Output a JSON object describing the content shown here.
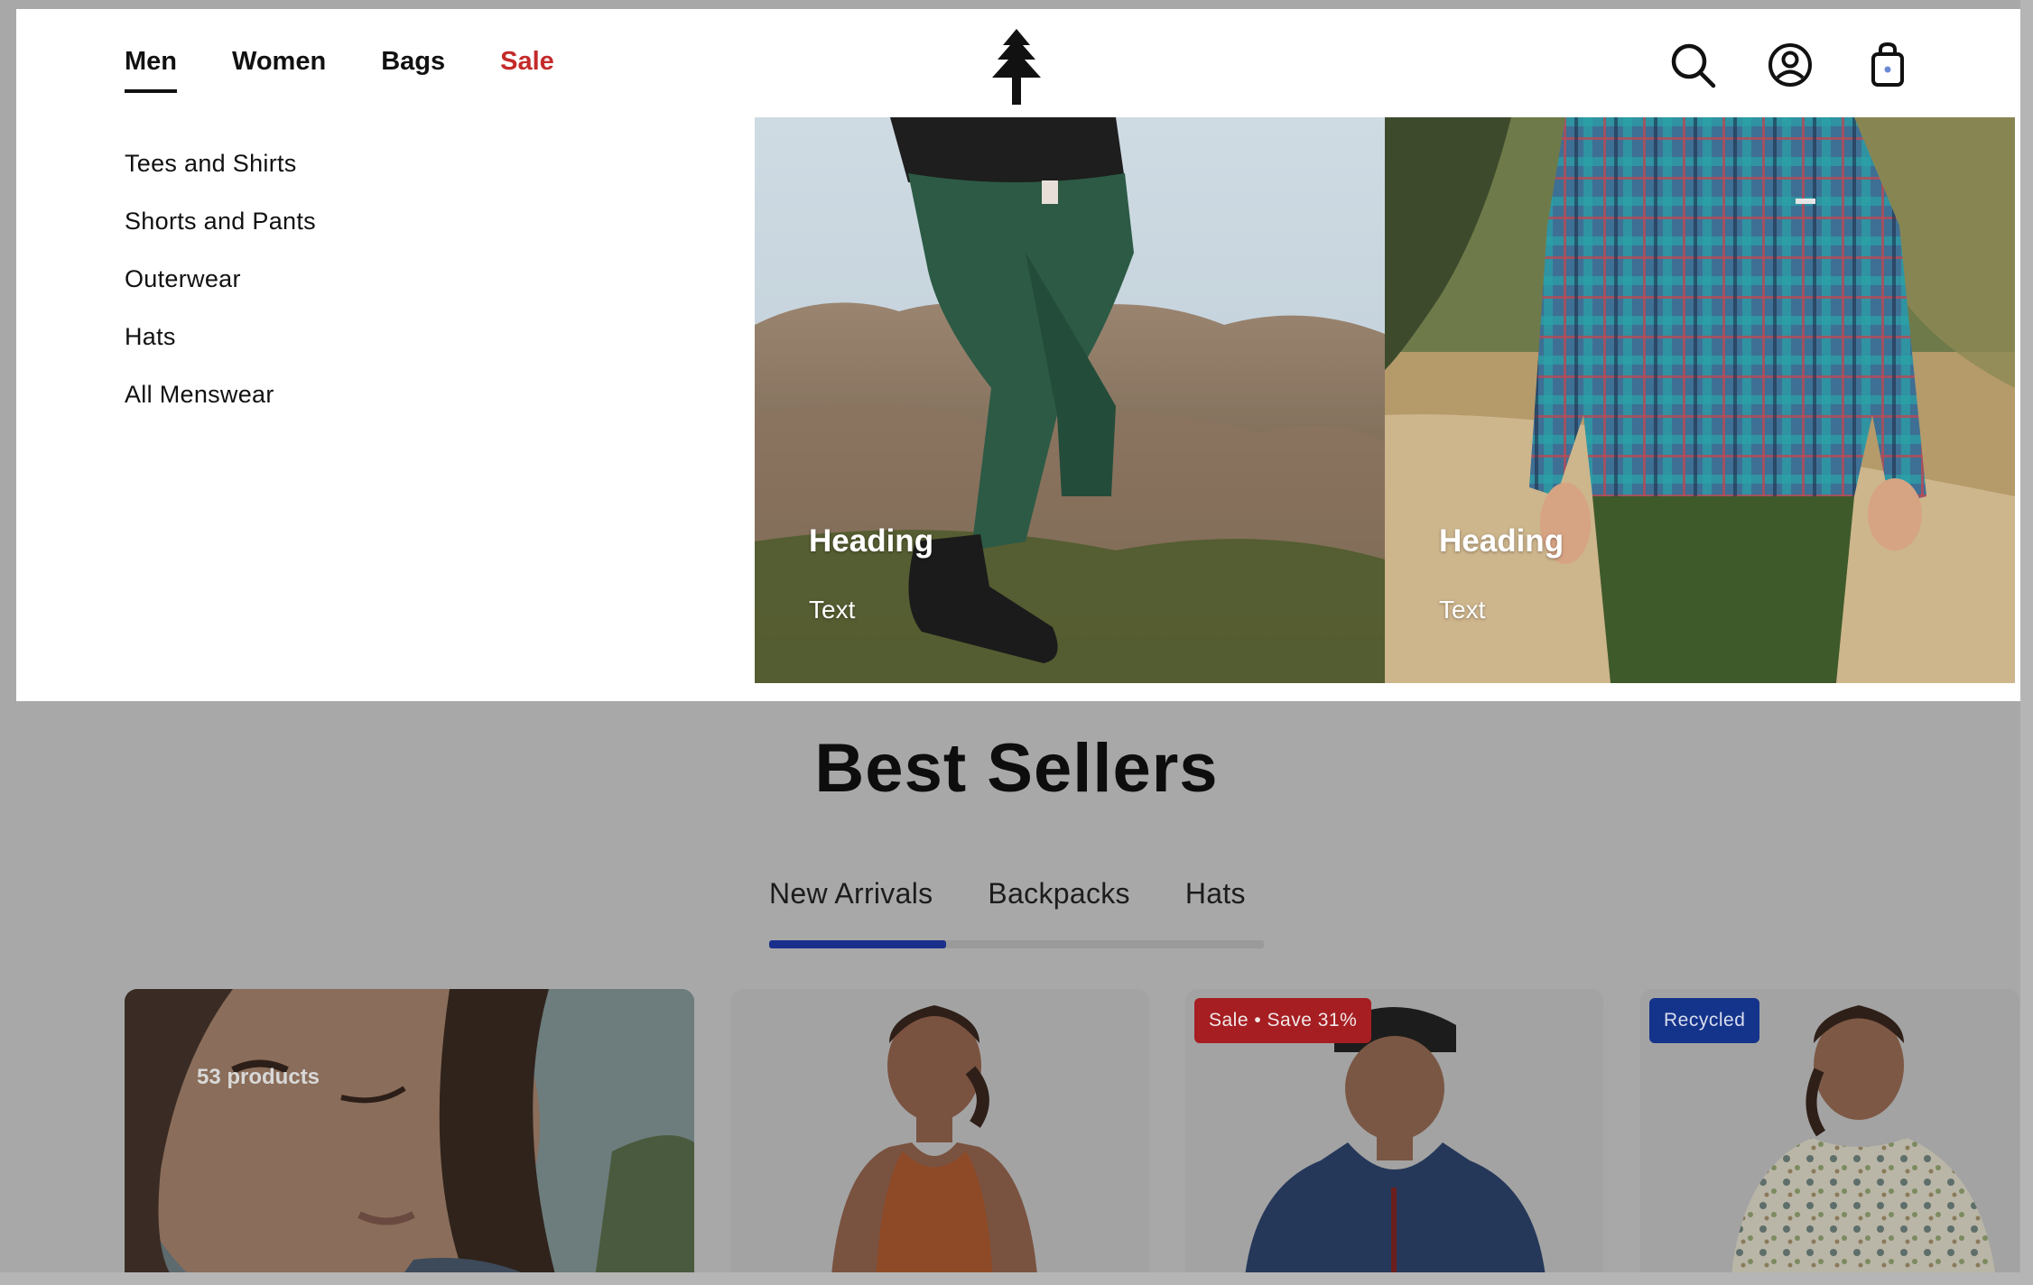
{
  "header": {
    "nav": [
      {
        "label": "Men",
        "active": true
      },
      {
        "label": "Women",
        "active": false
      },
      {
        "label": "Bags",
        "active": false
      },
      {
        "label": "Sale",
        "active": false,
        "color": "#c52a2a"
      }
    ],
    "logo_icon": "pine-tree-icon",
    "icons": [
      "search-icon",
      "account-icon",
      "cart-bag-icon"
    ]
  },
  "submenu": {
    "items": [
      "Tees and Shirts",
      "Shorts and Pants",
      "Outerwear",
      "Hats",
      "All Menswear"
    ]
  },
  "promos": [
    {
      "heading": "Heading",
      "text": "Text"
    },
    {
      "heading": "Heading",
      "text": "Text"
    }
  ],
  "best_sellers": {
    "title": "Best Sellers",
    "tabs": [
      "New Arrivals",
      "Backpacks",
      "Hats"
    ],
    "active_tab": 0
  },
  "cards": {
    "collection": {
      "count": "53 products"
    },
    "sale_badge": "Sale • Save 31%",
    "recycled_badge": "Recycled"
  },
  "colors": {
    "accent": "#1a2f8c",
    "sale": "#c52a2a",
    "overlay": "#a8a8a8"
  }
}
